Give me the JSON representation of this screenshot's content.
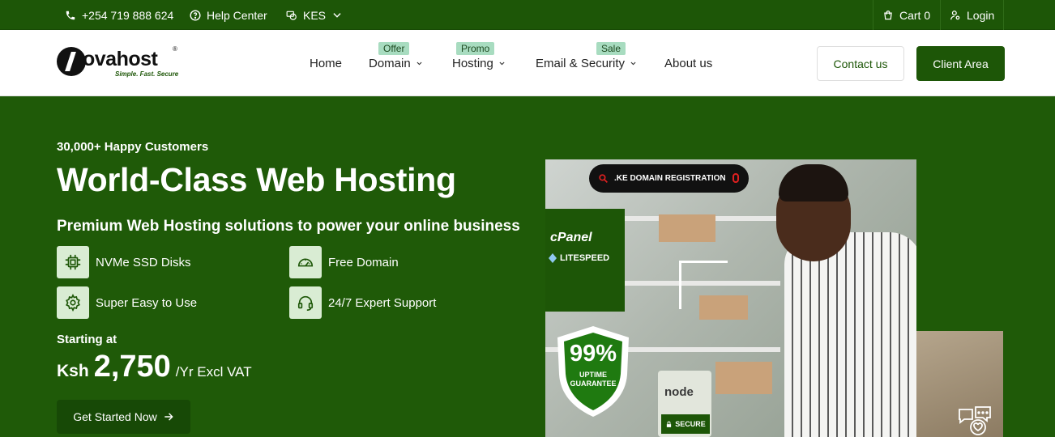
{
  "topbar": {
    "phone": "+254 719 888 624",
    "help": "Help Center",
    "currency": "KES",
    "cart": "Cart 0",
    "login": "Login"
  },
  "header": {
    "logo": {
      "brand": "ovahost",
      "registered": "®",
      "tagline": "Simple. Fast. Secure"
    },
    "nav": [
      {
        "label": "Home",
        "badge": ""
      },
      {
        "label": "Domain",
        "badge": "Offer"
      },
      {
        "label": "Hosting",
        "badge": "Promo"
      },
      {
        "label": "Email & Security",
        "badge": "Sale"
      },
      {
        "label": "About us",
        "badge": ""
      }
    ],
    "contact_label": "Contact us",
    "client_label": "Client Area"
  },
  "hero": {
    "kicker": "30,000+ Happy Customers",
    "title": "World-Class Web Hosting",
    "subtitle": "Premium Web Hosting solutions to power your online business",
    "features": [
      {
        "label": "NVMe SSD Disks",
        "icon": "chip-icon"
      },
      {
        "label": "Free Domain",
        "icon": "speedometer-icon"
      },
      {
        "label": "Super Easy to Use",
        "icon": "gear-icon"
      },
      {
        "label": "24/7 Expert Support",
        "icon": "headset-icon"
      }
    ],
    "price_label": "Starting at",
    "price_currency": "Ksh",
    "price_amount": "2,750",
    "price_period": "/Yr Excl VAT",
    "cta": "Get Started Now"
  },
  "visual": {
    "search_text": ".KE DOMAIN REGISTRATION",
    "cpanel": "cPanel",
    "litespeed": "LITESPEED",
    "uptime_pct": "99%",
    "uptime_line1": "UPTIME",
    "uptime_line2": "GUARANTEE",
    "node": "node",
    "secure": "SECURE",
    "colors": {
      "brand_green": "#1d5607",
      "badge_mint": "#a8dcc0"
    }
  }
}
